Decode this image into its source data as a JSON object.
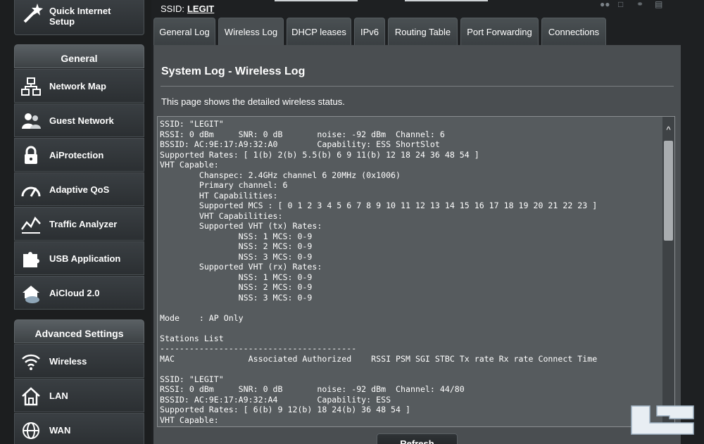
{
  "sidebar": {
    "qis_label": "Quick Internet\nSetup",
    "general_header": "General",
    "general_items": [
      {
        "label": "Network Map",
        "icon": "network-map-icon"
      },
      {
        "label": "Guest Network",
        "icon": "guest-network-icon"
      },
      {
        "label": "AiProtection",
        "icon": "lock-icon"
      },
      {
        "label": "Adaptive QoS",
        "icon": "gauge-icon"
      },
      {
        "label": "Traffic Analyzer",
        "icon": "chart-icon"
      },
      {
        "label": "USB Application",
        "icon": "puzzle-icon"
      },
      {
        "label": "AiCloud 2.0",
        "icon": "cloud-icon"
      }
    ],
    "advanced_header": "Advanced Settings",
    "advanced_items": [
      {
        "label": "Wireless",
        "icon": "wifi-icon"
      },
      {
        "label": "LAN",
        "icon": "home-icon"
      },
      {
        "label": "WAN",
        "icon": "globe-icon"
      }
    ]
  },
  "header": {
    "ssid_label": "SSID:",
    "ssid_value": "LEGIT"
  },
  "tabs": [
    {
      "label": "General Log"
    },
    {
      "label": "Wireless Log",
      "active": true
    },
    {
      "label": "DHCP leases"
    },
    {
      "label": "IPv6"
    },
    {
      "label": "Routing Table"
    },
    {
      "label": "Port Forwarding"
    },
    {
      "label": "Connections"
    }
  ],
  "main": {
    "title": "System Log - Wireless Log",
    "description": "This page shows the detailed wireless status.",
    "log_lines": [
      "SSID: \"LEGIT\"",
      "RSSI: 0 dBm     SNR: 0 dB       noise: -92 dBm  Channel: 6",
      "BSSID: AC:9E:17:A9:32:A0        Capability: ESS ShortSlot",
      "Supported Rates: [ 1(b) 2(b) 5.5(b) 6 9 11(b) 12 18 24 36 48 54 ]",
      "VHT Capable:",
      "        Chanspec: 2.4GHz channel 6 20MHz (0x1006)",
      "        Primary channel: 6",
      "        HT Capabilities:",
      "        Supported MCS : [ 0 1 2 3 4 5 6 7 8 9 10 11 12 13 14 15 16 17 18 19 20 21 22 23 ]",
      "        VHT Capabilities:",
      "        Supported VHT (tx) Rates:",
      "                NSS: 1 MCS: 0-9",
      "                NSS: 2 MCS: 0-9",
      "                NSS: 3 MCS: 0-9",
      "        Supported VHT (rx) Rates:",
      "                NSS: 1 MCS: 0-9",
      "                NSS: 2 MCS: 0-9",
      "                NSS: 3 MCS: 0-9",
      "",
      "Mode    : AP Only",
      "",
      "Stations List",
      "----------------------------------------",
      "MAC               Associated Authorized    RSSI PSM SGI STBC Tx rate Rx rate Connect Time",
      "",
      "SSID: \"LEGIT\"",
      "RSSI: 0 dBm     SNR: 0 dB       noise: -92 dBm  Channel: 44/80",
      "BSSID: AC:9E:17:A9:32:A4        Capability: ESS",
      "Supported Rates: [ 6(b) 9 12(b) 18 24(b) 36 48 54 ]",
      "VHT Capable:"
    ],
    "refresh_label": "Refresh"
  },
  "colors": {
    "panel_bg": "#4a4e51",
    "log_bg": "#565b5e",
    "page_bg": "#1e2022"
  }
}
